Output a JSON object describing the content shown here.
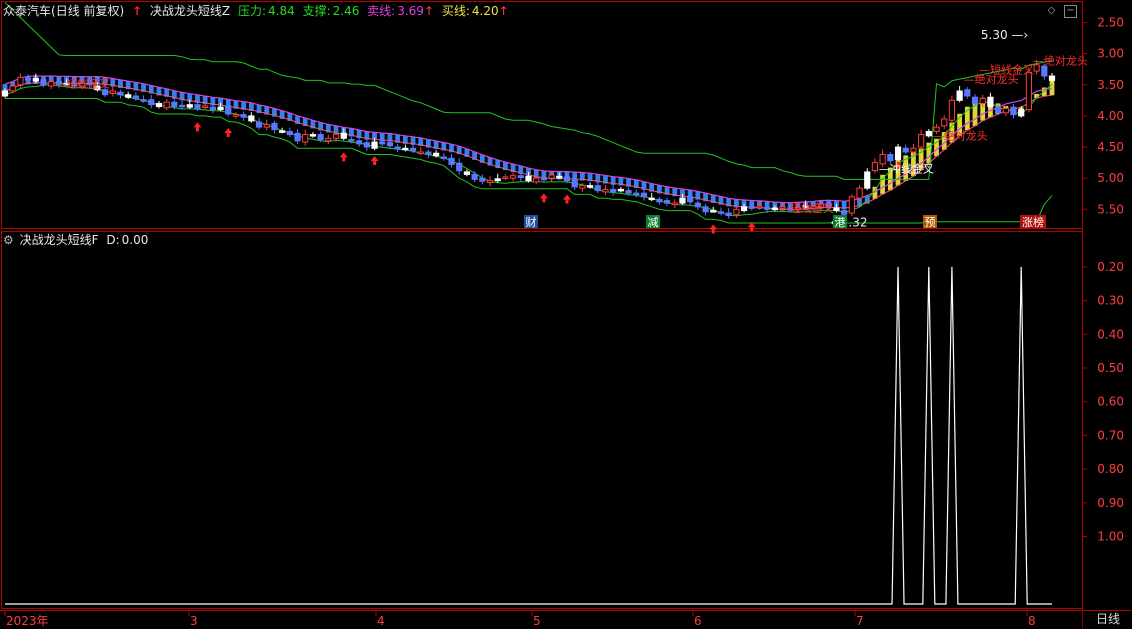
{
  "top_panel": {
    "stock_name": "众泰汽车",
    "period_info": "(日线 前复权)",
    "indicator_name": "决战龙头短线Z",
    "pressure": {
      "label": "压力:",
      "value": "4.84"
    },
    "support": {
      "label": "支撑:",
      "value": "2.46"
    },
    "sell_line": {
      "label": "卖线:",
      "value": "3.69"
    },
    "buy_line": {
      "label": "买线:",
      "value": "4.20"
    },
    "y_ticks": [
      "5.50",
      "5.00",
      "4.50",
      "4.00",
      "3.50",
      "3.00",
      "2.50"
    ],
    "high_marker": "5.30",
    "low_marker": "2.32",
    "annotations": [
      "短线金叉",
      "短线金叉",
      "绝对龙头",
      "绝对龙头",
      "绝对龙头",
      "冲线金叉",
      "短线金叉"
    ],
    "event_tags": [
      "财",
      "减",
      "港",
      "预",
      "涨榜"
    ]
  },
  "bottom_panel": {
    "indicator_name": "决战龙头短线F",
    "d_label": "D:",
    "d_value": "0.00",
    "y_ticks": [
      "1.00",
      "0.90",
      "0.80",
      "0.70",
      "0.60",
      "0.50",
      "0.40",
      "0.30",
      "0.20"
    ]
  },
  "x_axis": {
    "labels": [
      "2023年",
      "3",
      "4",
      "5",
      "6",
      "7",
      "8"
    ]
  },
  "period_button": "日线",
  "colors": {
    "up": "#ff3c3c",
    "down": "#5a78ff",
    "white": "#ffffff",
    "band_blue": "#2c8cff",
    "band_yellow": "#e8e23a",
    "pressure_line": "#22c322",
    "border": "#b30000",
    "tag_blue": "#1f4f9f",
    "tag_green": "#0f7f2f",
    "tag_orange": "#b05a00",
    "tag_red": "#b01010"
  },
  "chart_data": [
    {
      "type": "candlestick",
      "title": "决战龙头短线Z",
      "ylim": [
        2.2,
        5.62
      ],
      "y_ticks": [
        2.5,
        3.0,
        3.5,
        4.0,
        4.5,
        5.0,
        5.5
      ],
      "x_labels": [
        "2023年",
        "3",
        "4",
        "5",
        "6",
        "7",
        "8"
      ],
      "close": [
        4.4,
        4.48,
        4.62,
        4.6,
        4.56,
        4.5,
        4.55,
        4.5,
        4.52,
        4.48,
        4.52,
        4.5,
        4.42,
        4.34,
        4.4,
        4.34,
        4.3,
        4.28,
        4.26,
        4.18,
        4.15,
        4.22,
        4.15,
        4.16,
        4.18,
        4.12,
        4.16,
        4.1,
        4.14,
        4.03,
        4.02,
        3.98,
        3.92,
        3.82,
        3.86,
        3.78,
        3.75,
        3.7,
        3.6,
        3.7,
        3.68,
        3.62,
        3.64,
        3.7,
        3.64,
        3.6,
        3.55,
        3.5,
        3.58,
        3.55,
        3.52,
        3.48,
        3.46,
        3.44,
        3.42,
        3.38,
        3.36,
        3.32,
        3.22,
        3.12,
        3.06,
        2.98,
        2.95,
        2.96,
        2.99,
        3.02,
        3.04,
        3.01,
        2.96,
        3.0,
        2.98,
        3.05,
        3.02,
        2.96,
        2.86,
        2.88,
        2.86,
        2.8,
        2.82,
        2.78,
        2.82,
        2.76,
        2.74,
        2.7,
        2.66,
        2.62,
        2.6,
        2.6,
        2.68,
        2.62,
        2.54,
        2.46,
        2.48,
        2.44,
        2.4,
        2.5,
        2.54,
        2.52,
        2.55,
        2.5,
        2.52,
        2.54,
        2.5,
        2.52,
        2.56,
        2.54,
        2.58,
        2.54,
        2.48,
        2.42,
        2.7,
        2.84,
        3.1,
        3.25,
        3.38,
        3.28,
        3.5,
        3.42,
        3.48,
        3.7,
        3.75,
        3.82,
        3.95,
        4.25,
        4.4,
        4.32,
        4.2,
        4.28,
        4.15,
        4.05,
        4.12,
        4.02,
        4.1,
        4.7,
        4.82,
        4.64,
        4.57
      ],
      "pressure_line_start": 5.82,
      "pressure_value": 4.84,
      "support_value": 2.46,
      "high": 5.3,
      "low": 2.32
    },
    {
      "type": "line",
      "title": "决战龙头短线F",
      "ylim": [
        0,
        1.05
      ],
      "y_ticks": [
        0.2,
        0.3,
        0.4,
        0.5,
        0.6,
        0.7,
        0.8,
        0.9,
        1.0
      ],
      "series": [
        {
          "name": "D",
          "spikes_at_bar": [
            116,
            120,
            123,
            132
          ],
          "spike_value": 1.0,
          "last_value": 0.0
        }
      ]
    }
  ]
}
